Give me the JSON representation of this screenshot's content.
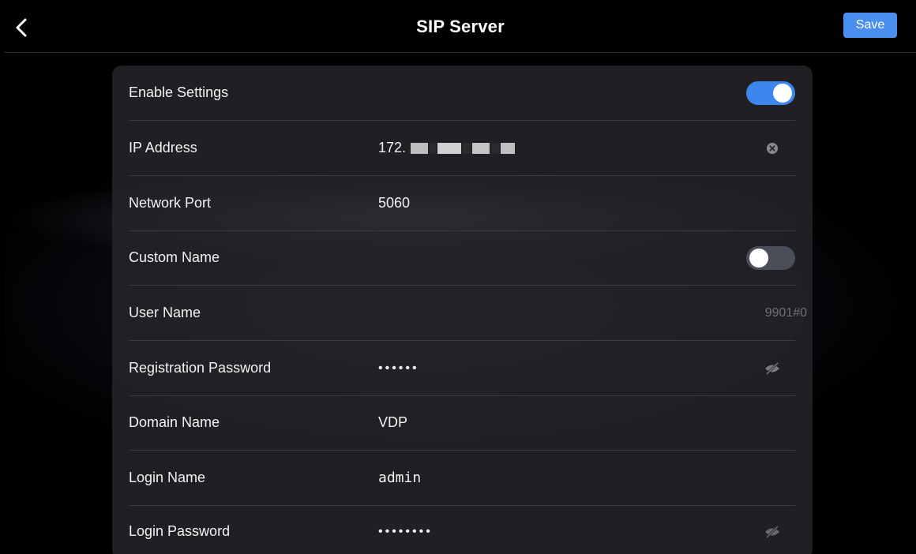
{
  "header": {
    "title": "SIP Server",
    "save_label": "Save"
  },
  "colors": {
    "accent": "#4a8ff0",
    "toggle_on": "#3d86ee",
    "toggle_off": "#4a4e58",
    "panel": "#242428"
  },
  "settings": {
    "enable": {
      "label": "Enable Settings",
      "enabled": true
    },
    "ip_address": {
      "label": "IP Address",
      "value": "172."
    },
    "network_port": {
      "label": "Network Port",
      "value": "5060"
    },
    "custom_name": {
      "label": "Custom Name",
      "enabled": false
    },
    "user_name": {
      "label": "User Name",
      "value": "9901#0"
    },
    "registration_password": {
      "label": "Registration Password",
      "value": "••••••"
    },
    "domain_name": {
      "label": "Domain Name",
      "value": "VDP"
    },
    "login_name": {
      "label": "Login Name",
      "value": "admin"
    },
    "login_password": {
      "label": "Login Password",
      "value": "••••••••"
    }
  },
  "icons": {
    "back": "chevron-left-icon",
    "clear": "clear-icon",
    "hidden": "eye-off-icon"
  }
}
